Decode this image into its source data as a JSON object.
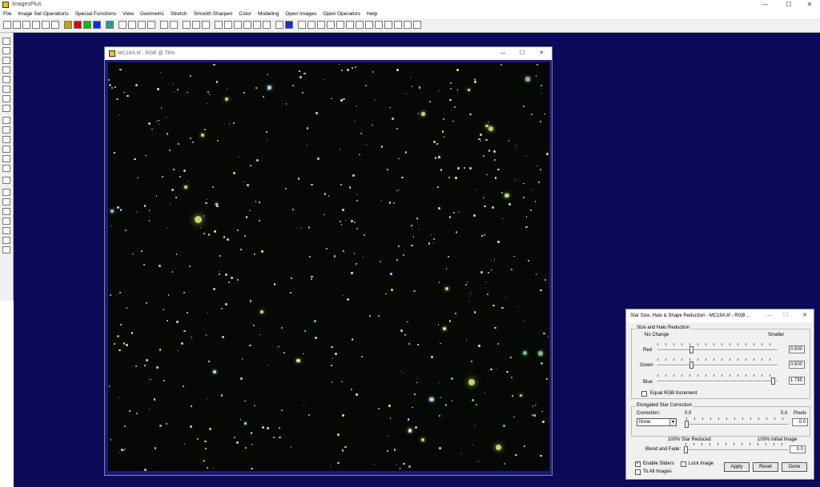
{
  "app": {
    "title": "ImagesPlus",
    "minimize": "—",
    "maximize": "☐",
    "close": "✕"
  },
  "menu": [
    "File",
    "Image Set Operations",
    "Special Functions",
    "View",
    "Geometric",
    "Stretch",
    "Smooth Sharpen",
    "Color",
    "Modeling",
    "Open Images",
    "Open Operators",
    "Help"
  ],
  "image_window": {
    "title": "MC19A.tif - RGB @ 78%",
    "minimize": "—",
    "maximize": "☐",
    "close": "✕"
  },
  "dialog": {
    "title": "Star Size, Halo & Shape Reduction - MC19A.tif - RGB ...",
    "minimize": "—",
    "maximize": "☐",
    "close": "✕",
    "size_group": {
      "label": "Size and Halo Reduction",
      "left_caption": "No Change",
      "right_caption": "Smaller",
      "sliders": [
        {
          "label": "Red",
          "value": "0.500",
          "fraction": 0.28
        },
        {
          "label": "Green",
          "value": "0.500",
          "fraction": 0.28
        },
        {
          "label": "Blue",
          "value": "1.795",
          "fraction": 0.96
        }
      ],
      "equal_increment": {
        "label": "Equal RGB Increment",
        "checked": false
      }
    },
    "elongated_group": {
      "label": "Elongated Star Correction",
      "correction_label": "Correction:",
      "correction_value": "None",
      "scale_min": "0.0",
      "scale_max": "5.0",
      "unit": "Pixels",
      "value": "0.0",
      "fraction": 0.0
    },
    "blend": {
      "left_caption": "100% Star Reduced",
      "right_caption": "100% Initial Image",
      "label": "Blend and Fade:",
      "value": "0.0",
      "fraction": 0.0
    },
    "enable_sliders": {
      "label": "Enable Sliders",
      "checked": true
    },
    "lock_image": {
      "label": "Lock Image",
      "checked": false
    },
    "to_all_images": {
      "label": "To All Images",
      "checked": false
    },
    "buttons": {
      "apply": "Apply",
      "reset": "Reset",
      "done": "Done"
    }
  }
}
